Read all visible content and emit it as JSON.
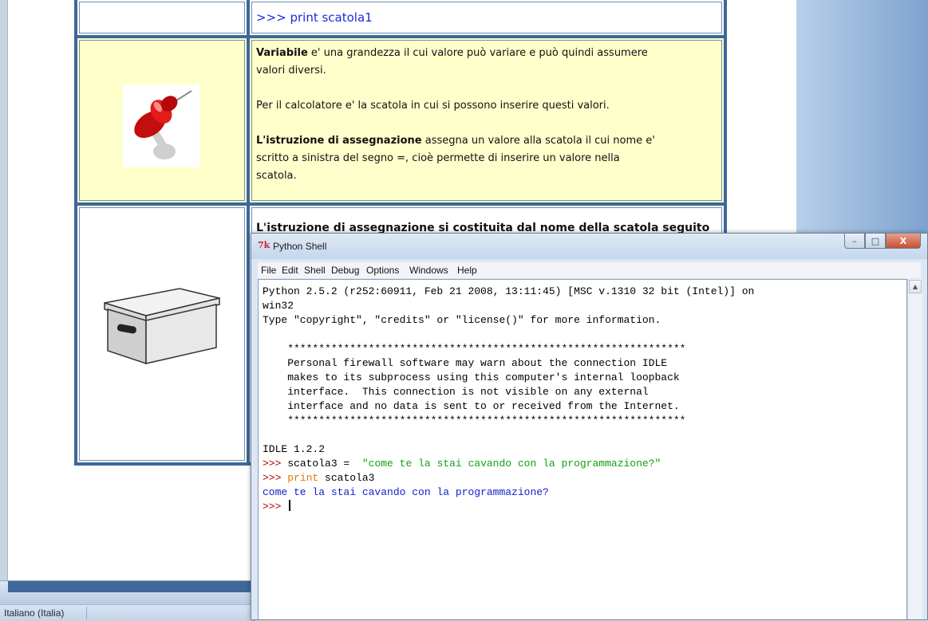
{
  "document": {
    "row0_code": ">>> print scatola1",
    "variabile_bold": "Variabile",
    "variabile_text_1": " e' una grandezza il cui valore può variare e può quindi assumere",
    "variabile_text_2": "valori diversi.",
    "calcolatore_text": "Per il calcolatore e' la scatola in cui si possono inserire questi valori.",
    "istruzione_bold": "L'istruzione di assegnazione",
    "istruzione_text_1": "  assegna un valore alla scatola il cui nome e'",
    "istruzione_text_2": "scritto a sinistra del segno =, cioè permette di inserire un valore nella",
    "istruzione_text_3": "scatola.",
    "row2_partial": "L'istruzione di assegnazione si costituita dal nome della scatola seguito"
  },
  "statusbar": {
    "language": "Italiano (Italia)"
  },
  "shell": {
    "tk_icon": "7k",
    "title": "Python Shell",
    "buttons": {
      "minimize": "–",
      "maximize": "□",
      "close": "X"
    },
    "menu": [
      "File",
      "Edit",
      "Shell",
      "Debug",
      "Options",
      "Windows",
      "Help"
    ],
    "lines": {
      "l1": "Python 2.5.2 (r252:60911, Feb 21 2008, 13:11:45) [MSC v.1310 32 bit (Intel)] on",
      "l2": "win32",
      "l3": "Type \"copyright\", \"credits\" or \"license()\" for more information.",
      "stars": "    ****************************************************************",
      "fw1": "    Personal firewall software may warn about the connection IDLE",
      "fw2": "    makes to its subprocess using this computer's internal loopback",
      "fw3": "    interface.  This connection is not visible on any external",
      "fw4": "    interface and no data is sent to or received from the Internet.",
      "idle": "IDLE 1.2.2",
      "prompt": ">>> ",
      "assign_code": "scatola3 =  ",
      "assign_str": "\"come te la stai cavando con la programmazione?\"",
      "print_kw": "print",
      "print_arg": " scatola3",
      "output": "come te la stai cavando con la programmazione?"
    }
  }
}
